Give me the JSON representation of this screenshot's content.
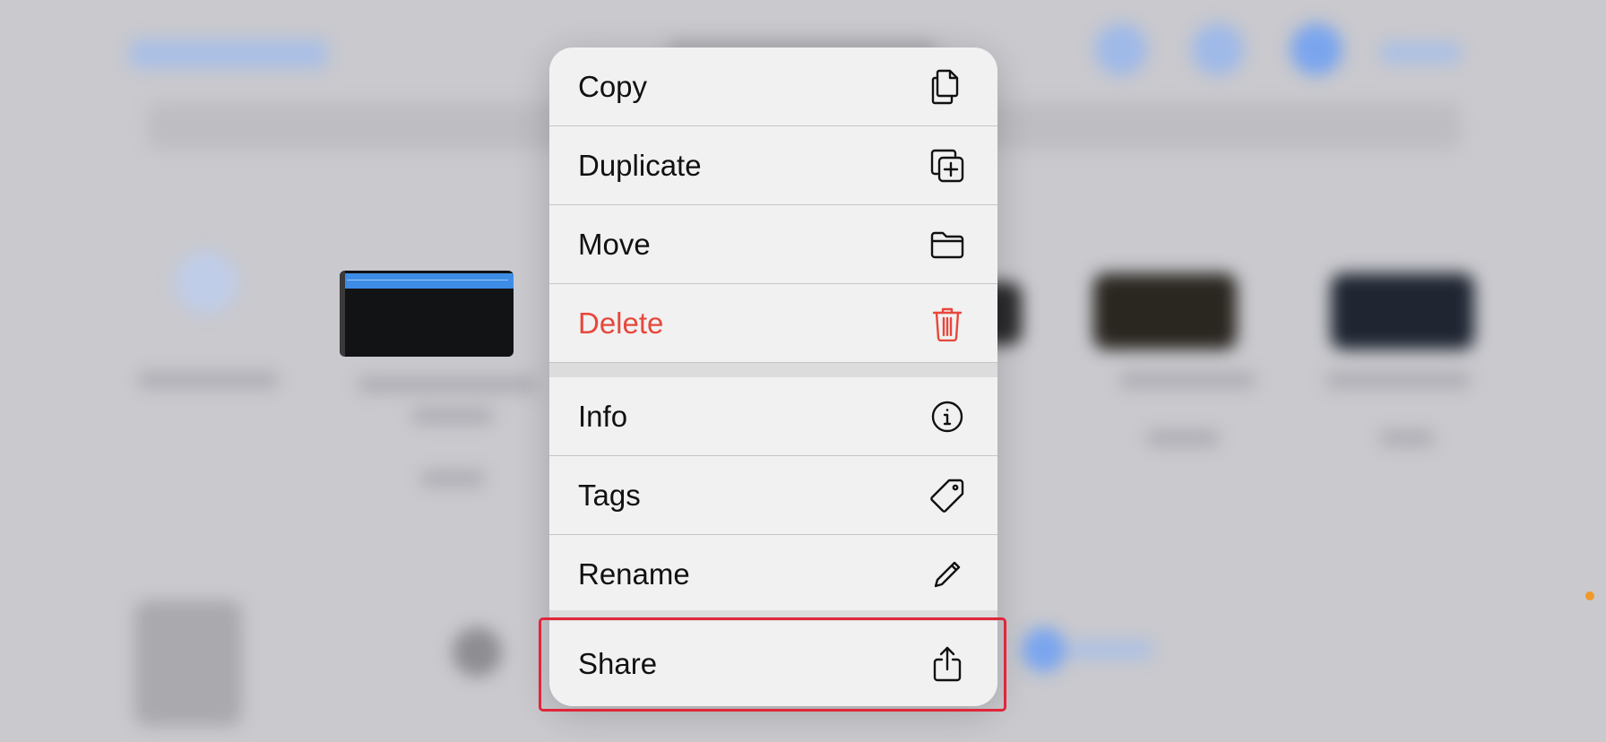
{
  "menu": {
    "items": [
      {
        "label": "Copy",
        "icon": "copy-icon",
        "style": "normal"
      },
      {
        "label": "Duplicate",
        "icon": "duplicate-icon",
        "style": "normal"
      },
      {
        "label": "Move",
        "icon": "folder-icon",
        "style": "normal"
      },
      {
        "label": "Delete",
        "icon": "trash-icon",
        "style": "destructive"
      },
      {
        "label": "Info",
        "icon": "info-icon",
        "style": "normal"
      },
      {
        "label": "Tags",
        "icon": "tag-icon",
        "style": "normal"
      },
      {
        "label": "Rename",
        "icon": "pencil-icon",
        "style": "normal"
      },
      {
        "label": "Share",
        "icon": "share-icon",
        "style": "normal",
        "highlighted": true
      }
    ]
  },
  "colors": {
    "destructive": "#e8473c",
    "highlight_border": "#e0263a",
    "menu_background": "#f1f1f1"
  }
}
